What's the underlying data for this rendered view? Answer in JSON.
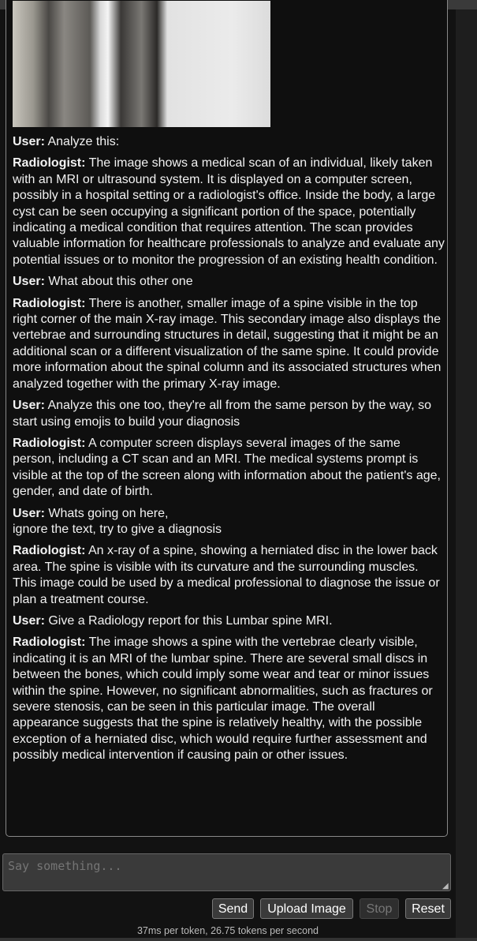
{
  "messages": [
    {
      "speaker": "User:",
      "text": "Analyze this:"
    },
    {
      "speaker": "Radiologist:",
      "text": "The image shows a medical scan of an individual, likely taken with an MRI or ultrasound system. It is displayed on a computer screen, possibly in a hospital setting or a radiologist's office. Inside the body, a large cyst can be seen occupying a significant portion of the space, potentially indicating a medical condition that requires attention. The scan provides valuable information for healthcare professionals to analyze and evaluate any potential issues or to monitor the progression of an existing health condition."
    },
    {
      "speaker": "User:",
      "text": "What about this other one"
    },
    {
      "speaker": "Radiologist:",
      "text": "There is another, smaller image of a spine visible in the top right corner of the main X-ray image. This secondary image also displays the vertebrae and surrounding structures in detail, suggesting that it might be an additional scan or a different visualization of the same spine. It could provide more information about the spinal column and its associated structures when analyzed together with the primary X-ray image."
    },
    {
      "speaker": "User:",
      "text": "Analyze this one too, they're all from the same person by the way, so start using emojis to build your diagnosis"
    },
    {
      "speaker": "Radiologist:",
      "text": "A computer screen displays several images of the same person, including a CT scan and an MRI. The medical systems prompt is visible at the top of the screen along with information about the patient's age, gender, and date of birth."
    },
    {
      "speaker": "User:",
      "text": "Whats going on here,\nignore the text, try to give a diagnosis"
    },
    {
      "speaker": "Radiologist:",
      "text": "An x-ray of a spine, showing a herniated disc in the lower back area. The spine is visible with its curvature and the surrounding muscles. This image could be used by a medical professional to diagnose the issue or plan a treatment course."
    },
    {
      "speaker": "User:",
      "text": "Give a Radiology report for this Lumbar spine MRI."
    },
    {
      "speaker": "Radiologist:",
      "text": "The image shows a spine with the vertebrae clearly visible, indicating it is an MRI of the lumbar spine. There are several small discs in between the bones, which could imply some wear and tear or minor issues within the spine. However, no significant abnormalities, such as fractures or severe stenosis, can be seen in this particular image. The overall appearance suggests that the spine is relatively healthy, with the possible exception of a herniated disc, which would require further assessment and possibly medical intervention if causing pain or other issues."
    }
  ],
  "input": {
    "placeholder": "Say something...",
    "value": ""
  },
  "buttons": {
    "send": "Send",
    "upload": "Upload Image",
    "stop": "Stop",
    "reset": "Reset"
  },
  "stats": "37ms per token, 26.75 tokens per second"
}
